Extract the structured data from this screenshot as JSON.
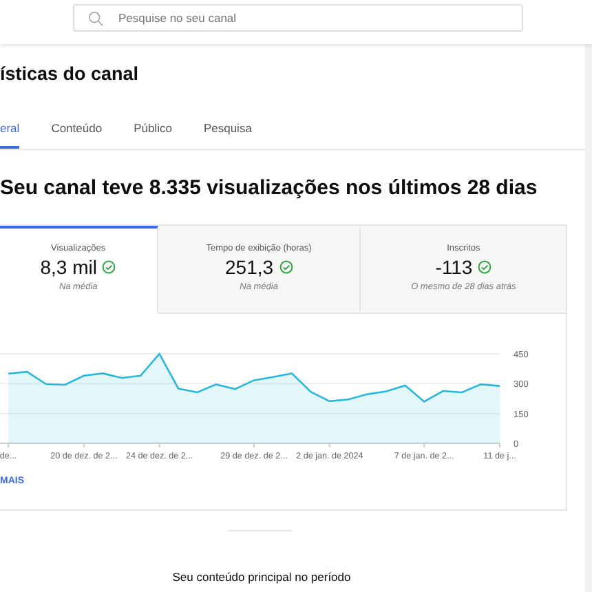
{
  "search": {
    "placeholder": "Pesquise no seu canal"
  },
  "page_title": "ísticas do canal",
  "tabs": [
    {
      "label": "eral",
      "selected": true
    },
    {
      "label": "Conteúdo",
      "selected": false
    },
    {
      "label": "Público",
      "selected": false
    },
    {
      "label": "Pesquisa",
      "selected": false
    }
  ],
  "summary": "Seu canal teve 8.335 visualizações nos últimos 28 dias",
  "metrics": [
    {
      "label": "Visualizações",
      "value": "8,3 mil",
      "note": "Na média",
      "selected": true
    },
    {
      "label": "Tempo de exibição (horas)",
      "value": "251,3",
      "note": "Na média",
      "selected": false
    },
    {
      "label": "Inscritos",
      "value": "-113",
      "note": "O mesmo de 28 dias atrás",
      "selected": false
    }
  ],
  "chart_data": {
    "type": "area",
    "categories": [
      "de...",
      null,
      null,
      null,
      "20 de dez. de 2...",
      null,
      null,
      null,
      "24 de dez. de 2...",
      null,
      null,
      null,
      null,
      "29 de dez. de 2...",
      null,
      null,
      null,
      "2 de jan. de 2024",
      null,
      null,
      null,
      null,
      "7 de jan. de 2...",
      null,
      null,
      null,
      "11 de j..."
    ],
    "series": [
      {
        "color": "#29b6d8",
        "values": [
          350,
          359,
          298,
          294,
          340,
          352,
          329,
          340,
          450,
          275,
          256,
          296,
          273,
          317,
          333,
          352,
          259,
          212,
          221,
          247,
          261,
          291,
          210,
          263,
          256,
          296,
          289
        ]
      }
    ],
    "ylim": [
      0,
      450
    ],
    "yticks": [
      0,
      150,
      300,
      450
    ]
  },
  "more_link": "MAIS",
  "section_title": "Seu conteúdo principal no período"
}
